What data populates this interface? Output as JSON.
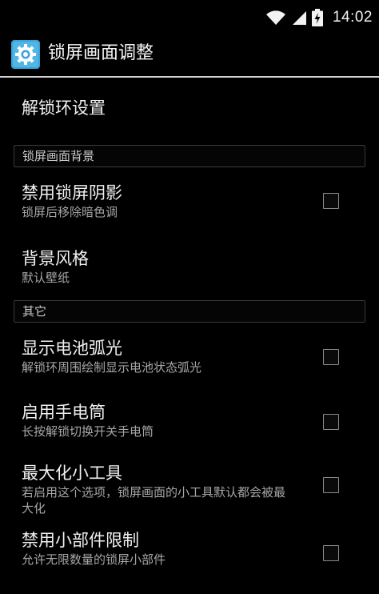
{
  "status_bar": {
    "time": "14:02",
    "icons": [
      "wifi-icon",
      "signal-icon",
      "battery-charging-icon"
    ]
  },
  "action_bar": {
    "icon": "settings-gear-icon",
    "title": "锁屏画面调整"
  },
  "items": {
    "unlock_ring": {
      "title": "解锁环设置"
    },
    "category_background": {
      "label": "锁屏画面背景"
    },
    "disable_shadow": {
      "title": "禁用锁屏阴影",
      "summary": "锁屏后移除暗色调",
      "checked": false
    },
    "background_style": {
      "title": "背景风格",
      "summary": "默认壁纸"
    },
    "category_other": {
      "label": "其它"
    },
    "battery_arc": {
      "title": "显示电池弧光",
      "summary": "解锁环周围绘制显示电池状态弧光",
      "checked": false
    },
    "flashlight": {
      "title": "启用手电筒",
      "summary": "长按解锁切换开关手电筒",
      "checked": false
    },
    "maximize_widgets": {
      "title": "最大化小工具",
      "summary": "若启用这个选项，锁屏画面的小工具默认都会被最大化",
      "checked": false
    },
    "disable_widget_limit": {
      "title": "禁用小部件限制",
      "summary": "允许无限数量的锁屏小部件",
      "checked": false
    }
  },
  "colors": {
    "background": "#000000",
    "divider": "#cfcfcf",
    "app_icon_bg": "#3aa3d8"
  }
}
